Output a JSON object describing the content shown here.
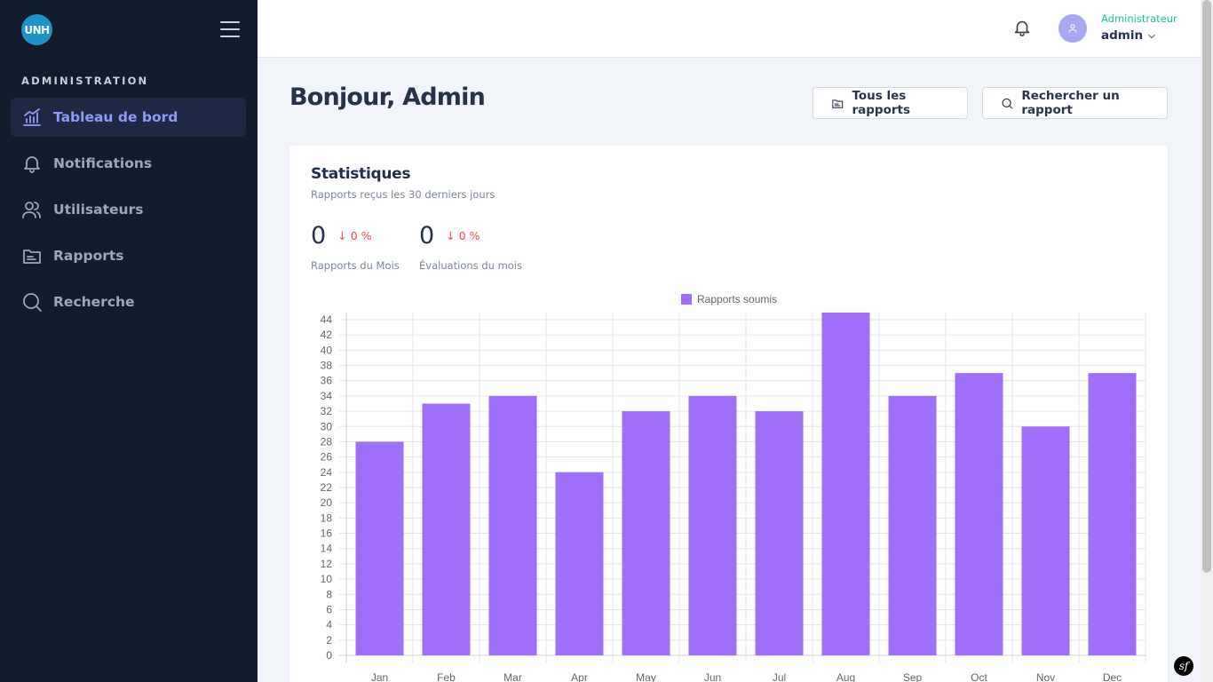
{
  "sidebar": {
    "logo_text": "UNH",
    "section_title": "ADMINISTRATION",
    "items": [
      {
        "label": "Tableau de bord",
        "icon": "chart-icon",
        "active": true
      },
      {
        "label": "Notifications",
        "icon": "bell-icon"
      },
      {
        "label": "Utilisateurs",
        "icon": "users-icon"
      },
      {
        "label": "Rapports",
        "icon": "folder-icon"
      },
      {
        "label": "Recherche",
        "icon": "search-icon"
      }
    ]
  },
  "topbar": {
    "role": "Administrateur",
    "username": "admin"
  },
  "main": {
    "title": "Bonjour, Admin",
    "buttons": {
      "all_reports": "Tous les rapports",
      "search_report": "Rechercher un rapport"
    },
    "stats": {
      "title": "Statistiques",
      "subtitle": "Rapports reçus les 30 derniers jours",
      "items": [
        {
          "value": "0",
          "delta": "↓ 0 %",
          "label": "Rapports du Mois"
        },
        {
          "value": "0",
          "delta": "↓ 0 %",
          "label": "Évaluations du mois"
        }
      ]
    }
  },
  "colors": {
    "bar": "#a06ff9",
    "accent": "#19c4a0",
    "sidebar_bg": "#131b2e",
    "negative": "#f24a4a"
  },
  "chart_data": {
    "type": "bar",
    "categories": [
      "Jan",
      "Feb",
      "Mar",
      "Apr",
      "May",
      "Jun",
      "Jul",
      "Aug",
      "Sep",
      "Oct",
      "Nov",
      "Dec"
    ],
    "series": [
      {
        "name": "Rapports soumis",
        "values": [
          28,
          33,
          34,
          24,
          32,
          34,
          32,
          45,
          34,
          37,
          30,
          37
        ]
      }
    ],
    "ylim": [
      0,
      44
    ],
    "y_ticks": [
      0,
      2,
      4,
      6,
      8,
      10,
      12,
      14,
      16,
      18,
      20,
      22,
      24,
      26,
      28,
      30,
      32,
      34,
      36,
      38,
      40,
      42,
      44
    ],
    "legend": "top-center",
    "grid": true
  }
}
